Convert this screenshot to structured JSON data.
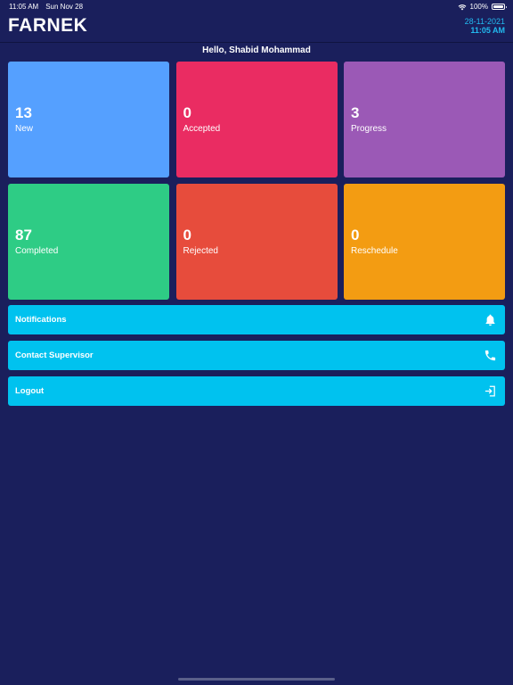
{
  "status_bar": {
    "time": "11:05 AM",
    "date": "Sun Nov 28",
    "battery": "100%"
  },
  "header": {
    "logo": "FARNEK",
    "date": "28-11-2021",
    "time": "11:05 AM"
  },
  "greeting": "Hello, Shabid Mohammad",
  "tiles": [
    {
      "count": "13",
      "label": "New",
      "color": "#55a0ff"
    },
    {
      "count": "0",
      "label": "Accepted",
      "color": "#ea2c62"
    },
    {
      "count": "3",
      "label": "Progress",
      "color": "#9b59b6"
    },
    {
      "count": "87",
      "label": "Completed",
      "color": "#2ecc85"
    },
    {
      "count": "0",
      "label": "Rejected",
      "color": "#e74c3c"
    },
    {
      "count": "0",
      "label": "Reschedule",
      "color": "#f39c12"
    }
  ],
  "actions": [
    {
      "label": "Notifications",
      "icon": "bell-icon"
    },
    {
      "label": "Contact Supervisor",
      "icon": "phone-icon"
    },
    {
      "label": "Logout",
      "icon": "logout-icon"
    }
  ],
  "colors": {
    "background": "#1a1f5c",
    "action_button": "#00c2ef",
    "accent_text": "#22b9ef"
  }
}
